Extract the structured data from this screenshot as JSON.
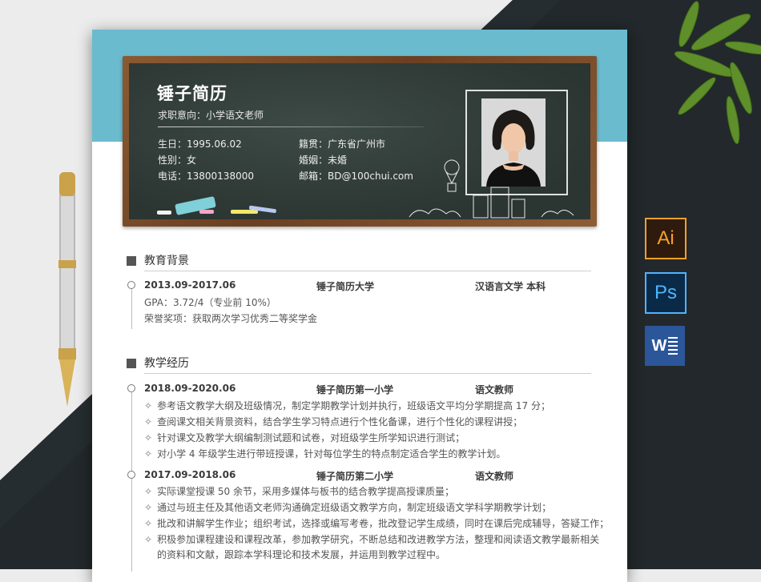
{
  "resume": {
    "name": "锤子简历",
    "objective": "求职意向：小学语文老师",
    "info": {
      "birthday": "生日：1995.06.02",
      "gender": "性别：女",
      "phone": "电话：13800138000",
      "hometown": "籍贯：广东省广州市",
      "marriage": "婚姻：未婚",
      "email": "邮箱：BD@100chui.com"
    }
  },
  "education": {
    "title": "教育背景",
    "period": "2013.09-2017.06",
    "school": "锤子简历大学",
    "major": "汉语言文学  本科",
    "gpa": "GPA：3.72/4（专业前 10%）",
    "honors": "荣誉奖项：获取两次学习优秀二等奖学金"
  },
  "teaching": {
    "title": "教学经历",
    "jobs": [
      {
        "period": "2018.09-2020.06",
        "org": "锤子简历第一小学",
        "role": "语文教师",
        "lines": [
          "参考语文教学大纲及班级情况，制定学期教学计划并执行，班级语文平均分学期提高 17 分；",
          "查阅课文相关背景资料，结合学生学习特点进行个性化备课，进行个性化的课程讲授；",
          "针对课文及教学大纲编制测试题和试卷，对班级学生所学知识进行测试；",
          "对小学 4 年级学生进行带班授课，针对每位学生的特点制定适合学生的教学计划。"
        ]
      },
      {
        "period": "2017.09-2018.06",
        "org": "锤子简历第二小学",
        "role": "语文教师",
        "lines": [
          "实际课堂授课 50 余节，采用多媒体与板书的结合教学提高授课质量；",
          "通过与班主任及其他语文老师沟通确定班级语文教学方向，制定班级语文学科学期教学计划；",
          "批改和讲解学生作业；组织考试，选择或编写考卷，批改登记学生成绩，同时在课后完成辅导，答疑工作；",
          "积极参加课程建设和课程改革，参加教学研究，不断总结和改进教学方法，整理和阅读语文教学最新相关",
          "的资料和文献，跟踪本学科理论和技术发展，并运用到教学过程中。"
        ]
      }
    ]
  },
  "bullet_glyph": "✧",
  "apps": {
    "ai": "Ai",
    "ps": "Ps",
    "word": "W"
  },
  "colors": {
    "band": "#6bbbcf",
    "board": "#2f3a37",
    "frame": "#7a4a28",
    "ai_bg": "#2e1b0d",
    "ai_fg": "#f7a02a",
    "ps_bg": "#0b2a47",
    "ps_fg": "#4fb4ff",
    "word_bg": "#2b579a"
  }
}
